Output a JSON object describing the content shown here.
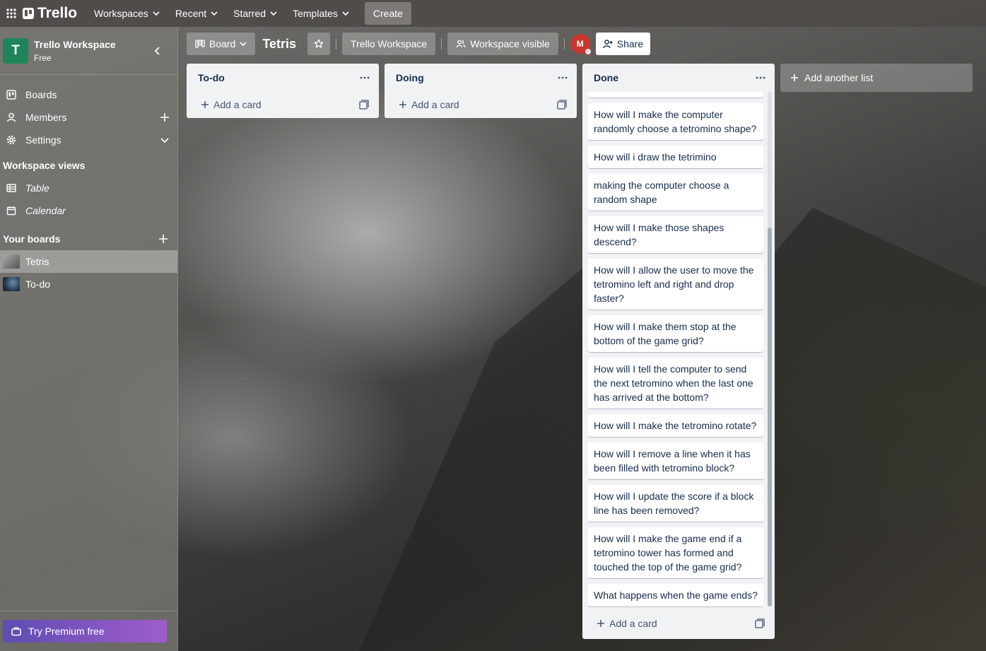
{
  "topbar": {
    "logo": "Trello",
    "nav": [
      {
        "label": "Workspaces"
      },
      {
        "label": "Recent"
      },
      {
        "label": "Starred"
      },
      {
        "label": "Templates"
      }
    ],
    "create_label": "Create"
  },
  "sidebar": {
    "workspace_initial": "T",
    "workspace_name": "Trello Workspace",
    "workspace_plan": "Free",
    "items": [
      {
        "label": "Boards"
      },
      {
        "label": "Members"
      },
      {
        "label": "Settings"
      }
    ],
    "views_title": "Workspace views",
    "views": [
      {
        "label": "Table"
      },
      {
        "label": "Calendar"
      }
    ],
    "boards_title": "Your boards",
    "boards": [
      {
        "label": "Tetris"
      },
      {
        "label": "To-do"
      }
    ],
    "premium_label": "Try Premium free"
  },
  "board": {
    "view_label": "Board",
    "title": "Tetris",
    "workspace_label": "Trello Workspace",
    "visibility_label": "Workspace visible",
    "member_initial": "M",
    "share_label": "Share"
  },
  "lists": [
    {
      "title": "To-do",
      "add_card_label": "Add a card"
    },
    {
      "title": "Doing",
      "add_card_label": "Add a card"
    },
    {
      "title": "Done",
      "add_card_label": "Add a card",
      "cards": [
        "How will I make the computer randomly choose a tetromino shape?",
        "How will i draw the tetrimino",
        "making the computer choose a random shape",
        "How will I make those shapes descend?",
        "How will I allow the user to move the tetromino left and right and drop faster?",
        "How will I make them stop at the bottom of the game grid?",
        "How will I tell the computer to send the next tetromino when the last one has arrived at the bottom?",
        "How will I make the tetromino rotate?",
        "How will I remove a line when it has been filled with tetromino block?",
        "How will I update the score if a block line has been removed?",
        "How will I make the game end if a tetromino tower has formed and touched the top of the game grid?",
        "What happens when the game ends?"
      ]
    }
  ],
  "add_list_label": "Add another list"
}
